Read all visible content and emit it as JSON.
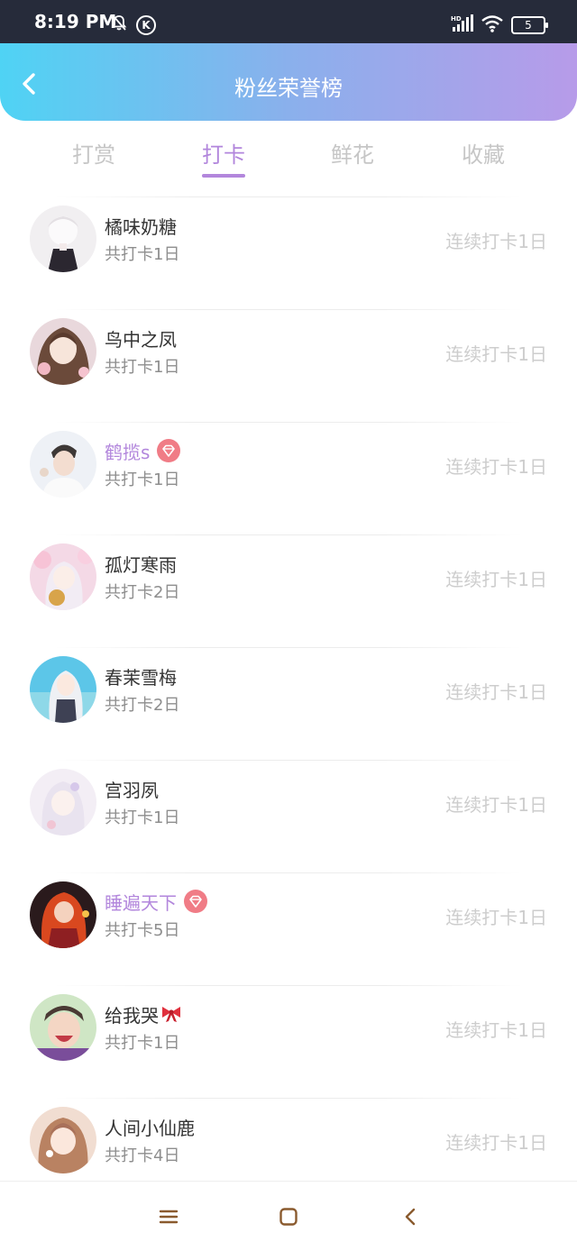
{
  "status_bar": {
    "time": "8:19 PM",
    "k_icon": "K",
    "battery": "5",
    "signal_label": "HD",
    "icons": [
      "bell-off-icon",
      "k-circle-icon",
      "signal-icon",
      "wifi-icon",
      "battery-icon"
    ]
  },
  "header": {
    "title": "粉丝荣誉榜",
    "back_icon": "chevron-left-icon"
  },
  "tabs": [
    {
      "label": "打赏",
      "active": false
    },
    {
      "label": "打卡",
      "active": true
    },
    {
      "label": "鲜花",
      "active": false
    },
    {
      "label": "收藏",
      "active": false
    }
  ],
  "colors": {
    "accent": "#b286dc",
    "header_start": "#4fd3f4",
    "header_end": "#b79be9",
    "vip_badge": "#f07c86"
  },
  "fans": [
    {
      "name": "橘味奶糖",
      "total": "共打卡1日",
      "streak": "连续打卡1日",
      "vip": false,
      "badge": ""
    },
    {
      "name": "鸟中之凤",
      "total": "共打卡1日",
      "streak": "连续打卡1日",
      "vip": false,
      "badge": ""
    },
    {
      "name": "鹤揽s",
      "total": "共打卡1日",
      "streak": "连续打卡1日",
      "vip": true,
      "badge": "diamond-icon"
    },
    {
      "name": "孤灯寒雨",
      "total": "共打卡2日",
      "streak": "连续打卡1日",
      "vip": false,
      "badge": ""
    },
    {
      "name": "春茉雪梅",
      "total": "共打卡2日",
      "streak": "连续打卡1日",
      "vip": false,
      "badge": ""
    },
    {
      "name": "宫羽夙",
      "total": "共打卡1日",
      "streak": "连续打卡1日",
      "vip": false,
      "badge": ""
    },
    {
      "name": "睡遍天下",
      "total": "共打卡5日",
      "streak": "连续打卡1日",
      "vip": true,
      "badge": "diamond-icon"
    },
    {
      "name": "给我哭",
      "total": "共打卡1日",
      "streak": "连续打卡1日",
      "vip": false,
      "badge": "bow-icon"
    },
    {
      "name": "人间小仙鹿",
      "total": "共打卡4日",
      "streak": "连续打卡1日",
      "vip": false,
      "badge": ""
    }
  ],
  "nav_bar": {
    "icons": [
      "menu-icon",
      "home-square-icon",
      "back-icon"
    ]
  }
}
